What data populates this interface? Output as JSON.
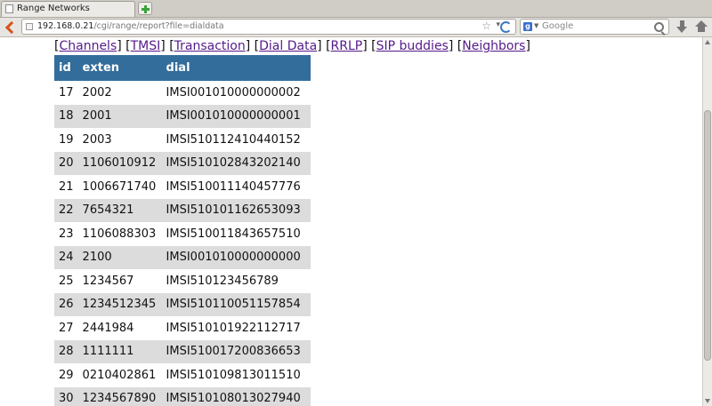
{
  "browser": {
    "tab_title": "Range Networks",
    "url_host": "192.168.0.21",
    "url_path": "/cgi/range/report?file=dialdata",
    "search_placeholder": "Google"
  },
  "nav_links": [
    "Channels",
    "TMSI",
    "Transaction",
    "Dial Data",
    "RRLP",
    "SIP buddies",
    "Neighbors"
  ],
  "table": {
    "headers": [
      "id",
      "exten",
      "dial"
    ],
    "rows": [
      [
        "17",
        "2002",
        "IMSI001010000000002"
      ],
      [
        "18",
        "2001",
        "IMSI001010000000001"
      ],
      [
        "19",
        "2003",
        "IMSI510112410440152"
      ],
      [
        "20",
        "1106010912",
        "IMSI510102843202140"
      ],
      [
        "21",
        "1006671740",
        "IMSI510011140457776"
      ],
      [
        "22",
        "7654321",
        "IMSI510101162653093"
      ],
      [
        "23",
        "1106088303",
        "IMSI510011843657510"
      ],
      [
        "24",
        "2100",
        "IMSI001010000000000"
      ],
      [
        "25",
        "1234567",
        "IMSI510123456789"
      ],
      [
        "26",
        "1234512345",
        "IMSI510110051157854"
      ],
      [
        "27",
        "2441984",
        "IMSI510101922112717"
      ],
      [
        "28",
        "1111111",
        "IMSI510017200836653"
      ],
      [
        "29",
        "0210402861",
        "IMSI510109813011510"
      ],
      [
        "30",
        "1234567890",
        "IMSI510108013027940"
      ]
    ]
  }
}
